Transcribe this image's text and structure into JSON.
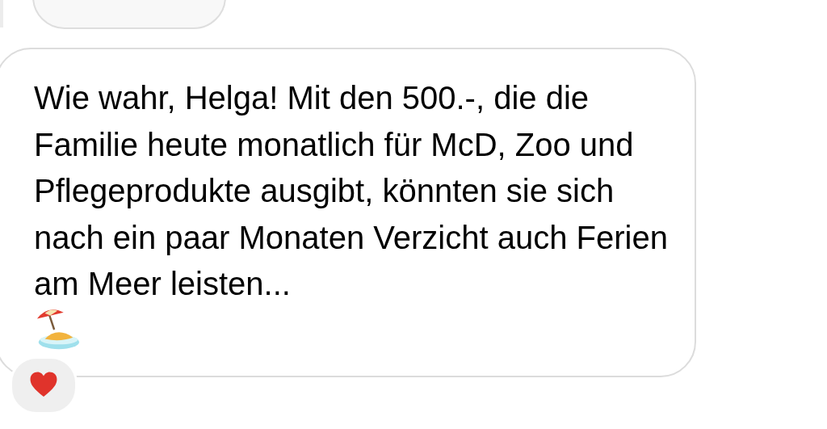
{
  "messages": [
    {
      "kind": "previous"
    },
    {
      "kind": "text",
      "text": "Wie wahr, Helga! Mit den 500.-, die die Familie heute monatlich für McD, Zoo und Pflegeprodukte ausgibt, könnten sie sich nach ein paar Monaten Verzicht auch Ferien am Meer leisten...",
      "emoji": {
        "kind": "island"
      },
      "reaction": {
        "kind": "heart"
      }
    }
  ]
}
